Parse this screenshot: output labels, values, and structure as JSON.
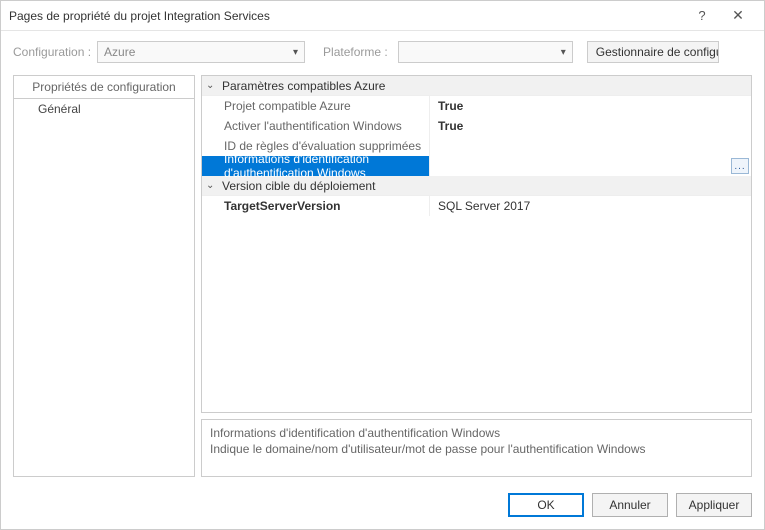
{
  "window": {
    "title": "Pages de propriété du projet Integration Services",
    "help": "?",
    "close": "✕"
  },
  "configRow": {
    "configLabel": "Configuration :",
    "configValue": "Azure",
    "platformLabel": "Plateforme :",
    "platformValue": "",
    "configMgrBtn": "Gestionnaire de configuration..."
  },
  "leftPanel": {
    "header": "Propriétés de configuration",
    "item0": "Général"
  },
  "propGrid": {
    "cat0": "Paramètres compatibles Azure",
    "rows0": {
      "r0": {
        "name": "Projet compatible Azure",
        "val": "True"
      },
      "r1": {
        "name": "Activer l'authentification Windows",
        "val": "True"
      },
      "r2": {
        "name": "ID de règles d'évaluation supprimées",
        "val": ""
      },
      "r3": {
        "name": "Informations d'identification d'authentification Windows",
        "val": ""
      }
    },
    "cat1": "Version cible du déploiement",
    "rows1": {
      "r0": {
        "name": "TargetServerVersion",
        "val": "SQL Server 2017"
      }
    }
  },
  "desc": {
    "title": "Informations d'identification d'authentification Windows",
    "body": "Indique le domaine/nom d'utilisateur/mot de passe pour l'authentification Windows"
  },
  "buttons": {
    "ok": "OK",
    "cancel": "Annuler",
    "apply": "Appliquer"
  },
  "ellipsis": "..."
}
